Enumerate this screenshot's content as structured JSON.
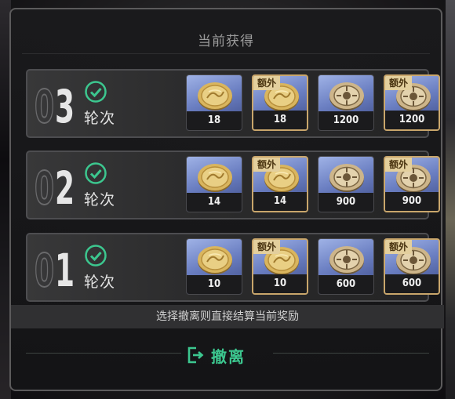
{
  "dialog": {
    "title": "当前获得",
    "hint": "选择撤离则直接结算当前奖励",
    "exit_label": "撤离"
  },
  "colors": {
    "accent": "#3cc78f",
    "extra_tag_bg": "#e3cf9d"
  },
  "extra_tag": "额外",
  "rounds": [
    {
      "num_0": "0",
      "num_1": "3",
      "label": "轮次",
      "status_icon": "check-circle-icon",
      "rewards": [
        {
          "qty": "18",
          "extra": false,
          "icon": "gold-coin-icon"
        },
        {
          "qty": "18",
          "extra": true,
          "icon": "gold-coin-icon"
        },
        {
          "qty": "1200",
          "extra": false,
          "icon": "medal-coin-icon"
        },
        {
          "qty": "1200",
          "extra": true,
          "icon": "medal-coin-icon"
        }
      ]
    },
    {
      "num_0": "0",
      "num_1": "2",
      "label": "轮次",
      "status_icon": "check-circle-icon",
      "rewards": [
        {
          "qty": "14",
          "extra": false,
          "icon": "gold-coin-icon"
        },
        {
          "qty": "14",
          "extra": true,
          "icon": "gold-coin-icon"
        },
        {
          "qty": "900",
          "extra": false,
          "icon": "medal-coin-icon"
        },
        {
          "qty": "900",
          "extra": true,
          "icon": "medal-coin-icon"
        }
      ]
    },
    {
      "num_0": "0",
      "num_1": "1",
      "label": "轮次",
      "status_icon": "check-circle-icon",
      "rewards": [
        {
          "qty": "10",
          "extra": false,
          "icon": "gold-coin-icon"
        },
        {
          "qty": "10",
          "extra": true,
          "icon": "gold-coin-icon"
        },
        {
          "qty": "600",
          "extra": false,
          "icon": "medal-coin-icon"
        },
        {
          "qty": "600",
          "extra": true,
          "icon": "medal-coin-icon"
        }
      ]
    }
  ]
}
